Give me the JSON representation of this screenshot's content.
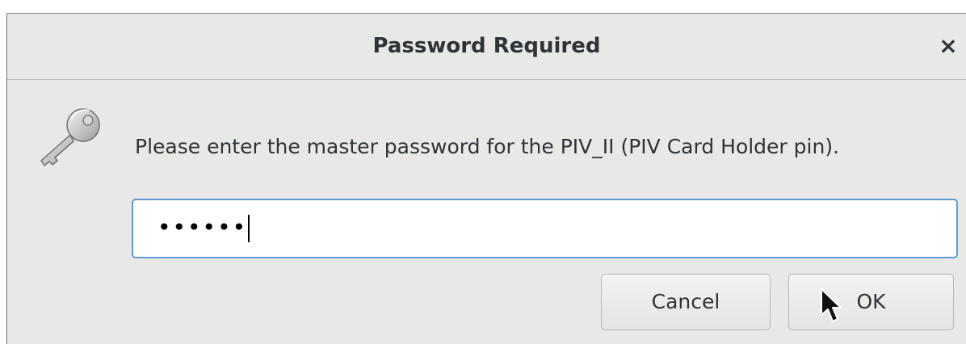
{
  "dialog": {
    "title": "Password Required",
    "close_symbol": "×",
    "icon": "key-icon",
    "message": "Please enter the master password for the PIV_II (PIV Card Holder pin).",
    "password_field": {
      "value_masked": "••••••",
      "character_count": 6
    },
    "buttons": {
      "cancel_label": "Cancel",
      "ok_label": "OK"
    }
  },
  "colors": {
    "dialog_background": "#e8e8e7",
    "focus_border": "#5e9ad6",
    "text": "#2e3436"
  }
}
